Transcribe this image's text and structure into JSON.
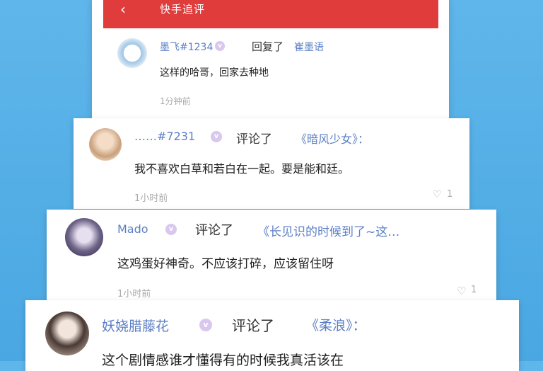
{
  "header": {
    "back_icon": "chevron-left-icon",
    "title": "快手追评"
  },
  "comments": [
    {
      "user": "墨飞#1234",
      "action": "回复了",
      "target": "崔墨语",
      "text": "这样的哈哥，回家去种地",
      "time": "1分钟前"
    },
    {
      "user": "……#7231",
      "action": "评论了",
      "target": "《暗风少女》：",
      "text": "我不喜欢白草和若白在一起。要是能和廷。",
      "time": "1小时前",
      "likes": "1"
    },
    {
      "user": "Mado",
      "action": "评论了",
      "target": "《长见识的时候到了~这…",
      "text": "这鸡蛋好神奇。不应该打碎，应该留住呀",
      "time": "1小时前",
      "likes": "1"
    },
    {
      "user": "妖娆腊藤花",
      "action": "评论了",
      "target": "《柔浪》：",
      "text": "这个剧情感谁才懂得有的时候我真活该在"
    }
  ],
  "colors": {
    "header": "#e03c3c",
    "link": "#5b7fc5",
    "background": "#4aa7e2"
  }
}
